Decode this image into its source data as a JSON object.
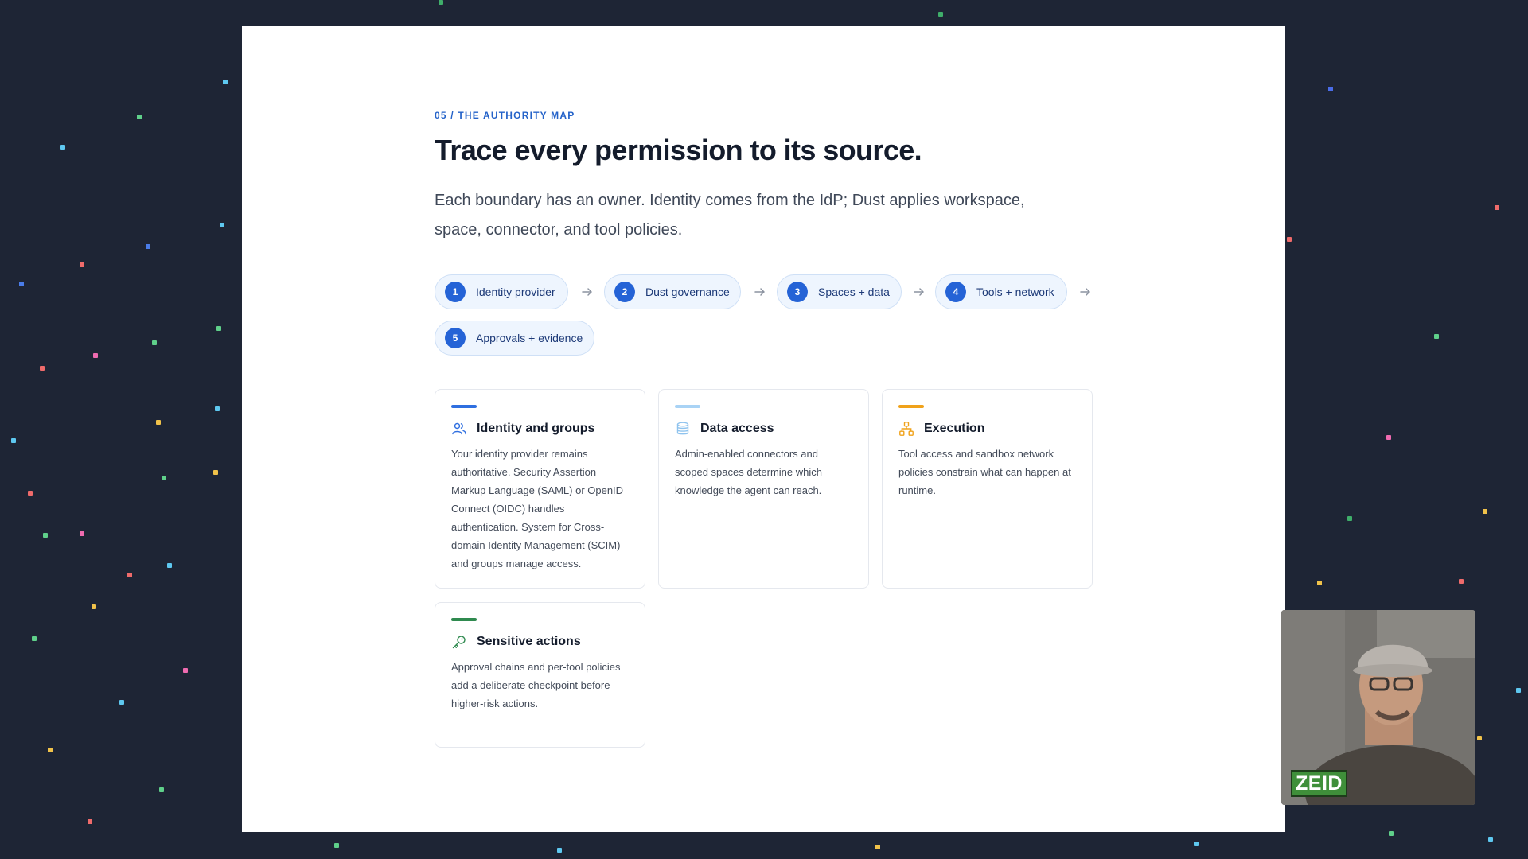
{
  "slide": {
    "eyebrow": "05 / THE AUTHORITY MAP",
    "title": "Trace every permission to its source.",
    "lead": "Each boundary has an owner. Identity comes from the IdP; Dust applies workspace, space, connector, and tool policies.",
    "steps": [
      {
        "number": "1",
        "label": "Identity provider"
      },
      {
        "number": "2",
        "label": "Dust governance"
      },
      {
        "number": "3",
        "label": "Spaces + data"
      },
      {
        "number": "4",
        "label": "Tools + network"
      },
      {
        "number": "5",
        "label": "Approvals + evidence"
      }
    ],
    "cards": [
      {
        "title": "Identity and groups",
        "icon": "users-icon",
        "accent": "#2f6fe0",
        "body": "Your identity provider remains authoritative. Security Assertion Markup Language (SAML) or OpenID Connect (OIDC) handles authentication. System for Cross-domain Identity Management (SCIM) and groups manage access."
      },
      {
        "title": "Data access",
        "icon": "database-icon",
        "accent": "#a9d3f5",
        "body": "Admin-enabled connectors and scoped spaces determine which knowledge the agent can reach."
      },
      {
        "title": "Execution",
        "icon": "network-icon",
        "accent": "#f0a21a",
        "body": "Tool access and sandbox network policies constrain what can happen at runtime."
      },
      {
        "title": "Sensitive actions",
        "icon": "key-icon",
        "accent": "#2f8a4f",
        "body": "Approval chains and per-tool policies add a deliberate checkpoint before higher-risk actions."
      }
    ]
  },
  "webcam": {
    "badge": "ZEID"
  }
}
